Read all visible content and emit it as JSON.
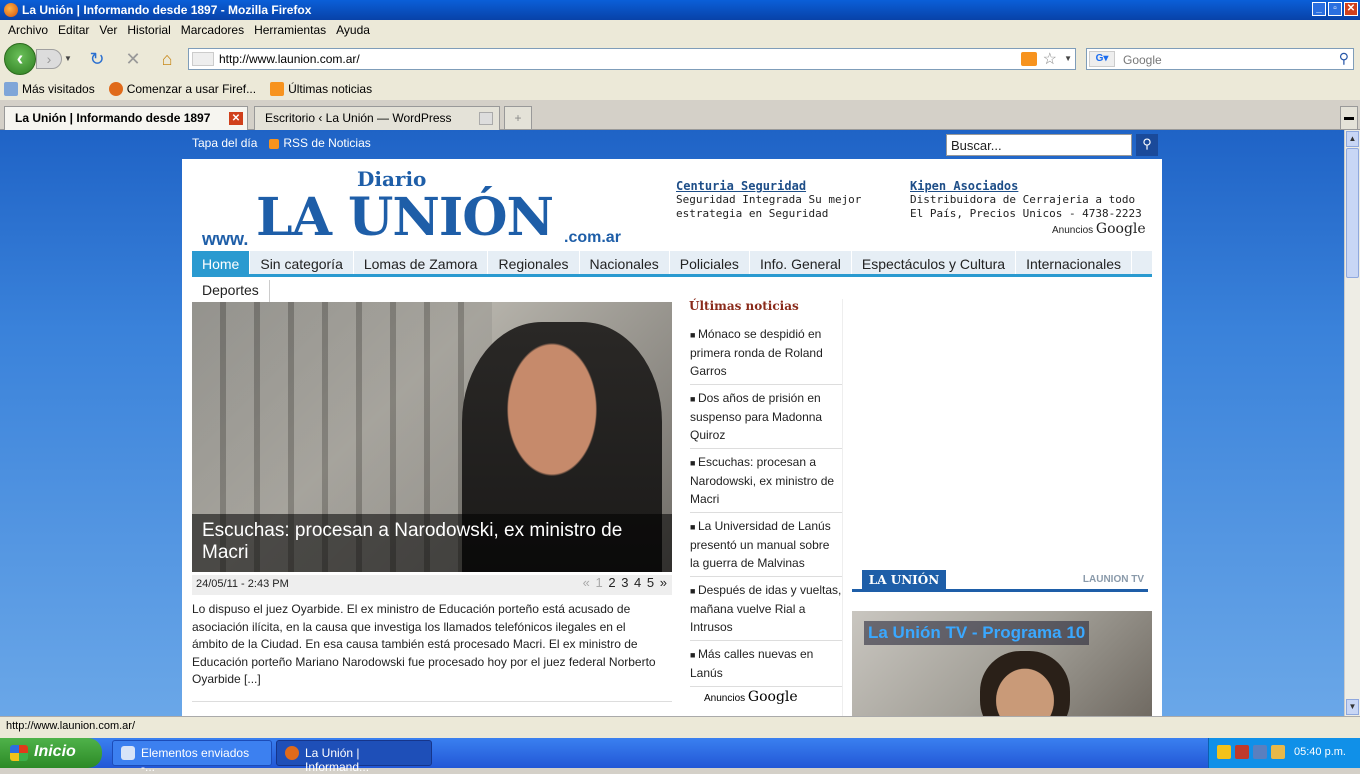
{
  "window": {
    "title": "La Unión | Informando desde 1897 - Mozilla Firefox"
  },
  "menu": [
    "Archivo",
    "Editar",
    "Ver",
    "Historial",
    "Marcadores",
    "Herramientas",
    "Ayuda"
  ],
  "navbar": {
    "url": "http://www.launion.com.ar/",
    "search_placeholder": "Google"
  },
  "bookmarks": [
    "Más visitados",
    "Comenzar a usar Firef...",
    "Últimas noticias"
  ],
  "tabs": [
    {
      "label": "La Unión | Informando desde 1897",
      "active": true
    },
    {
      "label": "Escritorio ‹ La Unión — WordPress",
      "active": false
    }
  ],
  "site": {
    "top_links": {
      "tapa": "Tapa del día",
      "rss": "RSS de Noticias"
    },
    "search_value": "Buscar...",
    "logo": {
      "diario": "Diario",
      "www": "www.",
      "name": "LA UNIÓN",
      "domain": ".com.ar"
    },
    "ads": [
      {
        "title": "Centuria Seguridad",
        "desc": "Seguridad Integrada Su mejor estrategia en Seguridad"
      },
      {
        "title": "Kipen Asociados",
        "desc": "Distribuidora de Cerrajeria a todo El País, Precios Unicos - 4738-2223"
      }
    ],
    "ads_label": "Anuncios",
    "ads_brand": "Google",
    "nav": [
      "Home",
      "Sin categoría",
      "Lomas de Zamora",
      "Regionales",
      "Nacionales",
      "Policiales",
      "Info. General",
      "Espectáculos y Cultura",
      "Internacionales"
    ],
    "nav_row2": [
      "Deportes"
    ],
    "feature": {
      "caption": "Escuchas: procesan a Narodowski, ex ministro de Macri",
      "date": "24/05/11 - 2:43 PM",
      "pager": {
        "prev": "«",
        "pages": [
          "1",
          "2",
          "3",
          "4",
          "5"
        ],
        "next": "»"
      },
      "excerpt": "Lo dispuso el juez Oyarbide. El ex ministro de Educación porteño está acusado de asociación ilícita, en la causa que investiga los llamados telefónicos ilegales en el ámbito de la Ciudad. En esa causa también está procesado Macri. El ex ministro de Educación porteño Mariano Narodowski fue procesado hoy por el juez federal Norberto Oyarbide [...]"
    },
    "latest": {
      "heading": "Últimas noticias",
      "items": [
        "Mónaco se despidió en primera ronda de Roland Garros",
        "Dos años de prisión en suspenso para Madonna Quiroz",
        "Escuchas: procesan a Narodowski, ex ministro de Macri",
        "La Universidad de Lanús presentó un manual sobre la guerra de Malvinas",
        "Después de idas y vueltas, mañana vuelve Rial a Intrusos",
        "Más calles nuevas en Lanús"
      ]
    },
    "tv": {
      "banner_left": "LA UNIÓN",
      "banner_right": "LAUNION TV",
      "video_title": "La Unión TV - Programa 10"
    }
  },
  "status": "http://www.launion.com.ar/",
  "taskbar": {
    "start": "Inicio",
    "tasks": [
      "Elementos enviados -...",
      "La Unión | Informand..."
    ],
    "clock": "05:40 p.m."
  }
}
